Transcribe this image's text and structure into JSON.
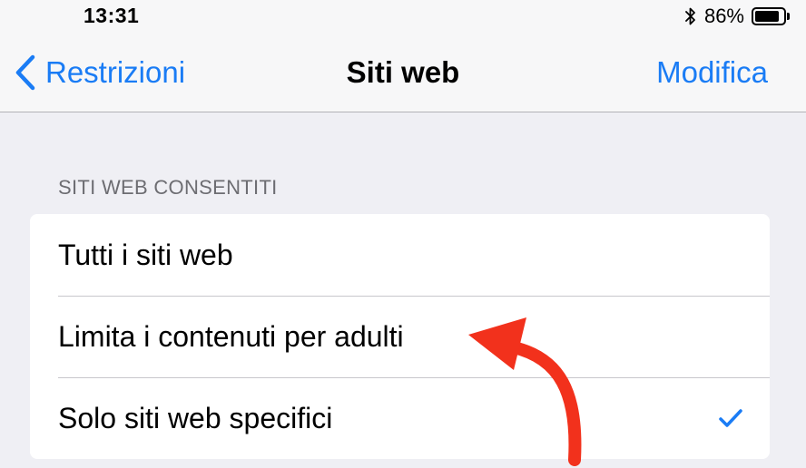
{
  "status_bar": {
    "time": "13:31",
    "battery_percent": "86%",
    "battery_level": 0.86,
    "icons": [
      "bluetooth-icon",
      "battery-icon"
    ]
  },
  "nav": {
    "back_label": "Restrizioni",
    "title": "Siti web",
    "edit_label": "Modifica"
  },
  "section": {
    "header": "SITI WEB CONSENTITI",
    "options": [
      {
        "label": "Tutti i siti web",
        "selected": false
      },
      {
        "label": "Limita i contenuti per adulti",
        "selected": false
      },
      {
        "label": "Solo siti web specifici",
        "selected": true
      }
    ]
  },
  "colors": {
    "accent": "#1a7cf5",
    "annotation_arrow": "#f2311c",
    "background": "#efeff4"
  }
}
